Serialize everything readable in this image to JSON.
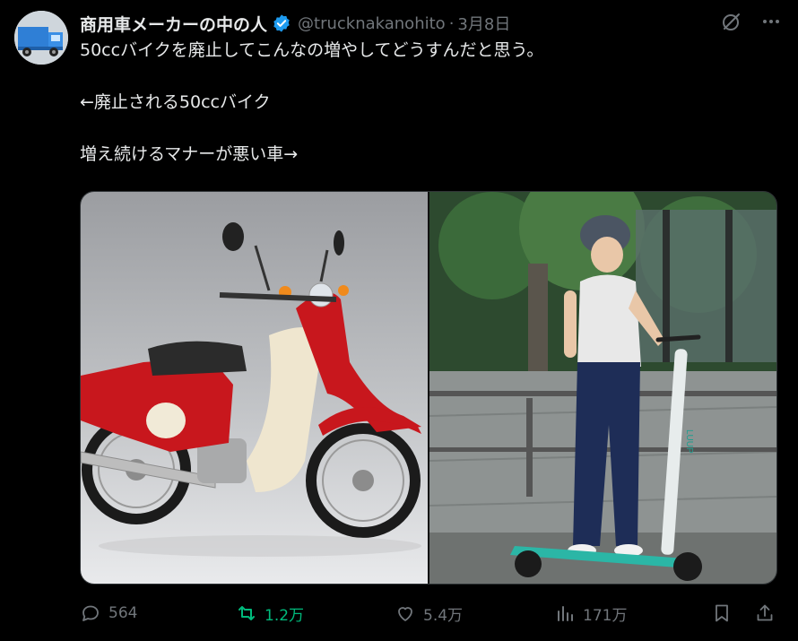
{
  "author": {
    "display_name": "商用車メーカーの中の人",
    "handle": "@trucknakanohito",
    "separator": "·",
    "date": "3月8日",
    "verified": true
  },
  "tweet": {
    "lines": [
      "50ccバイクを廃止してこんなの増やしてどうすんだと思う。",
      "",
      "←廃止される50ccバイク",
      "",
      "増え続けるマナーが悪い車→"
    ]
  },
  "media": {
    "left_image": "red-50cc-motorbike",
    "right_image": "woman-on-electric-kickscooter",
    "scooter_brand": "LUUP"
  },
  "actions": {
    "replies": "564",
    "retweets": "1.2万",
    "likes": "5.4万",
    "views": "171万"
  },
  "colors": {
    "background": "#000000",
    "text": "#e7e9ea",
    "muted": "#71767b",
    "retweet_green": "#00ba7c",
    "verified_blue": "#1d9bf0"
  }
}
